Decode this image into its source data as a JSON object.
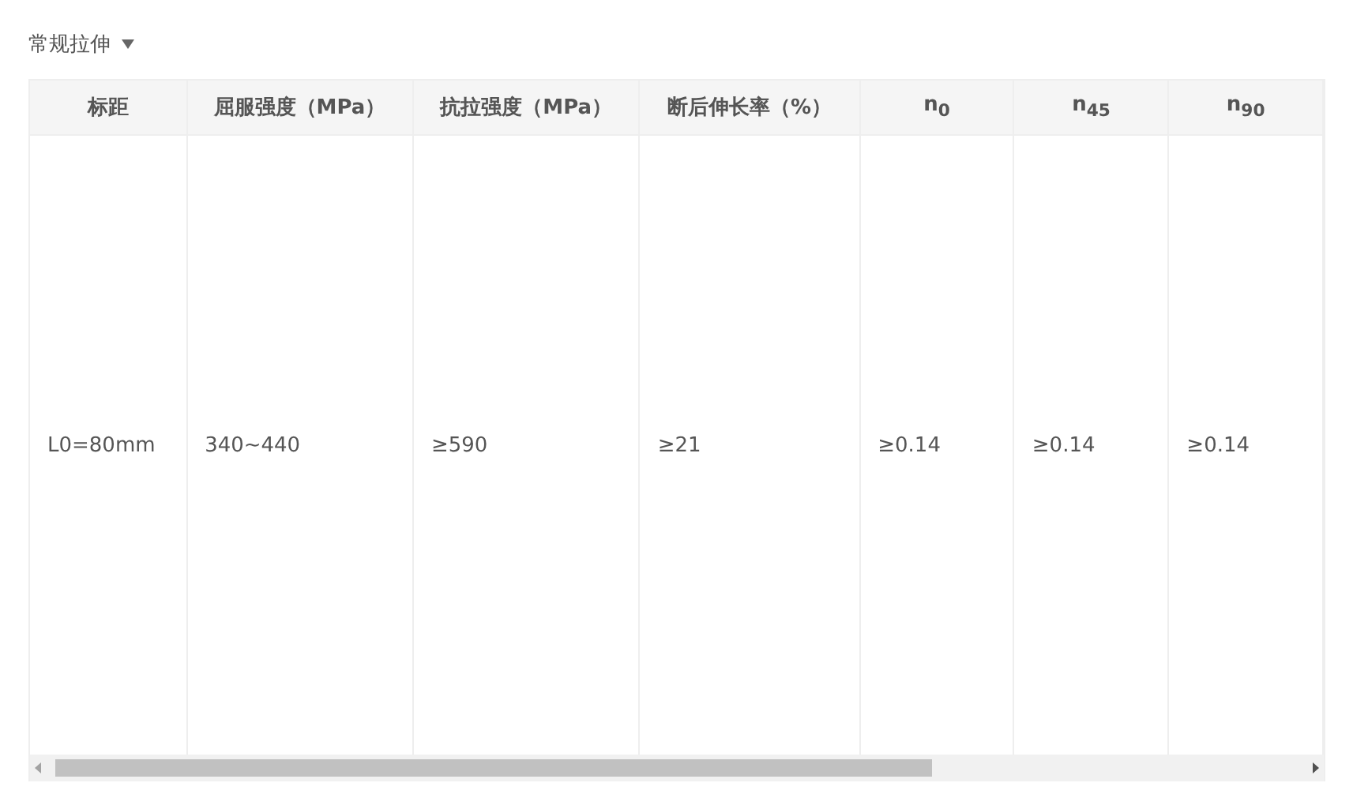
{
  "dropdown": {
    "label": "常规拉伸"
  },
  "table": {
    "columns": [
      "标距",
      "屈服强度（MPa）",
      "抗拉强度（MPa）",
      "断后伸长率（%）",
      "n$_{0}$",
      "n$_{45}$",
      "n$_{90}$"
    ],
    "rows": [
      [
        "L0=80mm",
        "340~440",
        "≥590",
        "≥21",
        "≥0.14",
        "≥0.14",
        "≥0.14"
      ]
    ]
  }
}
